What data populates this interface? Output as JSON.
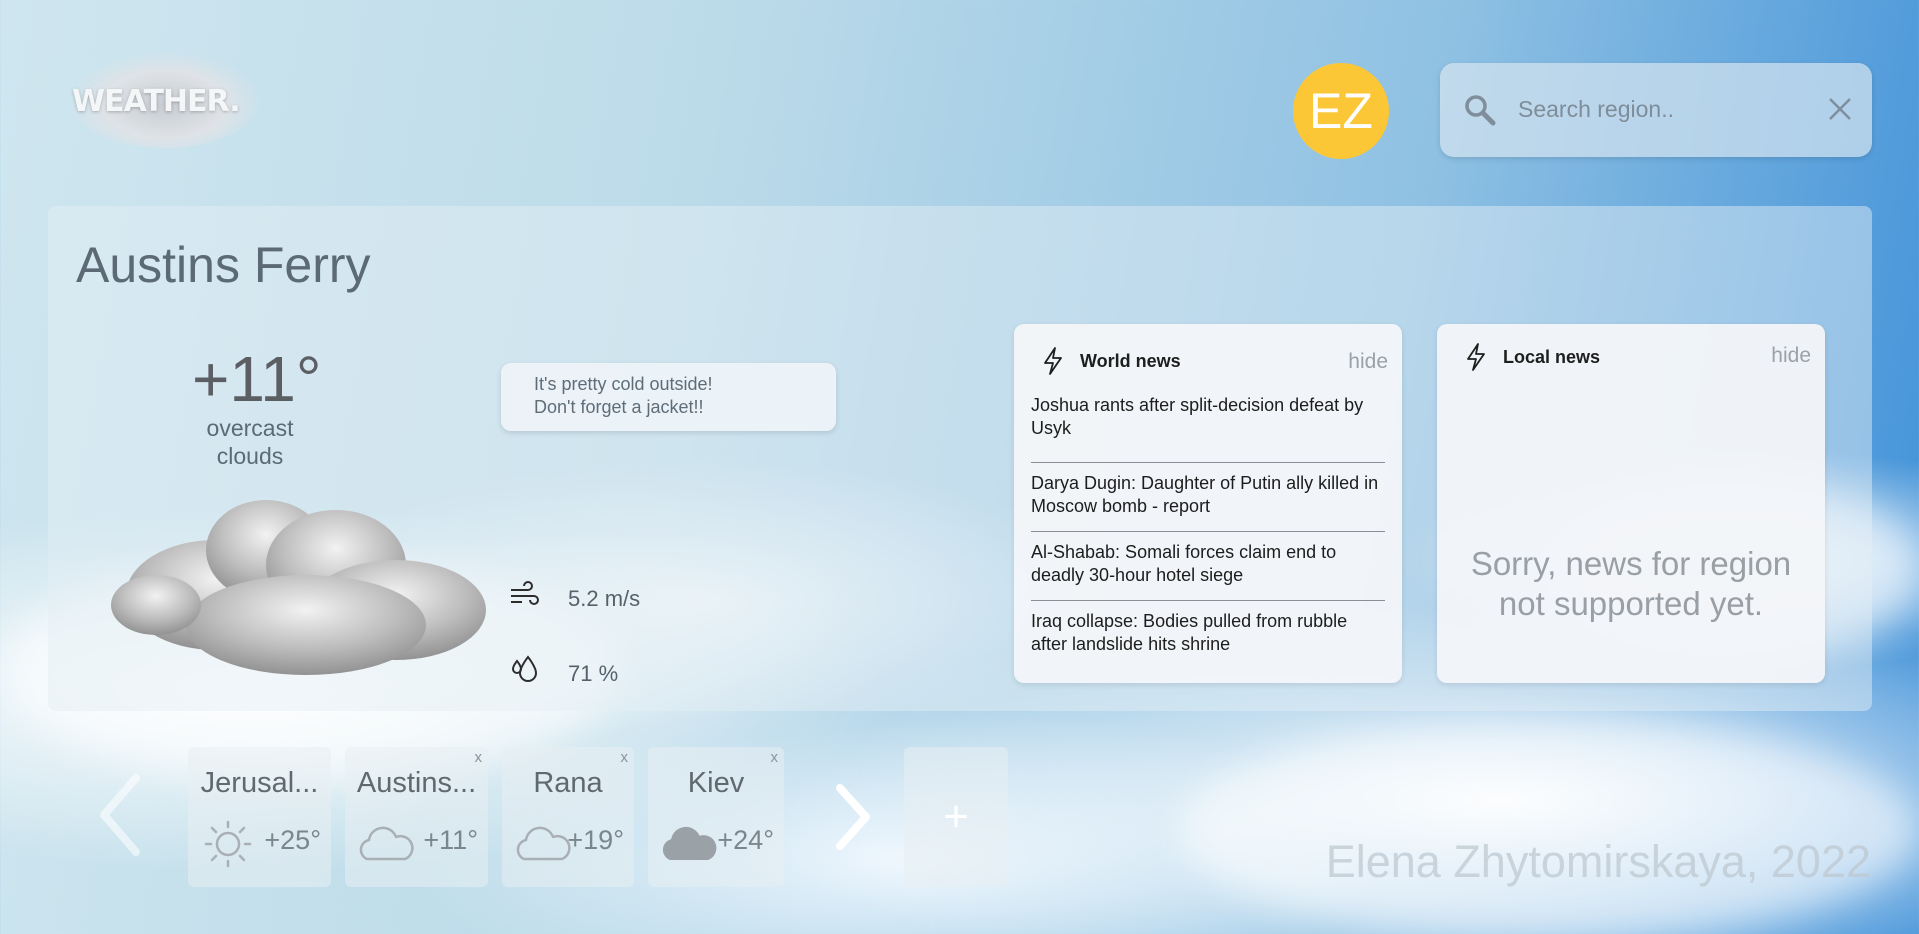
{
  "header": {
    "logo_text": "WEATHER.",
    "avatar_initials": "EZ",
    "avatar_color": "#fbc737",
    "search_placeholder": "Search region.."
  },
  "current": {
    "city": "Austins Ferry",
    "temperature": "+11°",
    "condition": "overcast clouds",
    "tip_line1": "It's pretty cold outside!",
    "tip_line2": "Don't forget a jacket!!",
    "wind": "5.2 m/s",
    "humidity": "71 %",
    "icons": [
      "cloud-icon",
      "wind-icon",
      "humidity-icon"
    ]
  },
  "world_news": {
    "title": "World news",
    "hide_label": "hide",
    "items": [
      "Joshua rants after split-decision defeat by Usyk",
      "Darya Dugin: Daughter of Putin ally killed in Moscow bomb - report",
      "Al-Shabab: Somali forces claim end to deadly 30-hour hotel siege",
      "Iraq collapse: Bodies pulled from rubble after landslide hits shrine"
    ]
  },
  "local_news": {
    "title": "Local news",
    "hide_label": "hide",
    "message": "Sorry, news for region not supported yet."
  },
  "favorites": {
    "items": [
      {
        "name": "Jerusal...",
        "temp": "+25°",
        "icon": "sun-icon",
        "removable": false
      },
      {
        "name": "Austins...",
        "temp": "+11°",
        "icon": "cloud-outline-icon",
        "removable": true,
        "remove_label": "x"
      },
      {
        "name": "Rana",
        "temp": "+19°",
        "icon": "cloud-outline-icon",
        "removable": true,
        "remove_label": "x"
      },
      {
        "name": "Kiev",
        "temp": "+24°",
        "icon": "cloud-filled-icon",
        "removable": true,
        "remove_label": "x"
      }
    ],
    "add_label": "+"
  },
  "footer": {
    "credit": "Elena Zhytomirskaya, 2022"
  }
}
